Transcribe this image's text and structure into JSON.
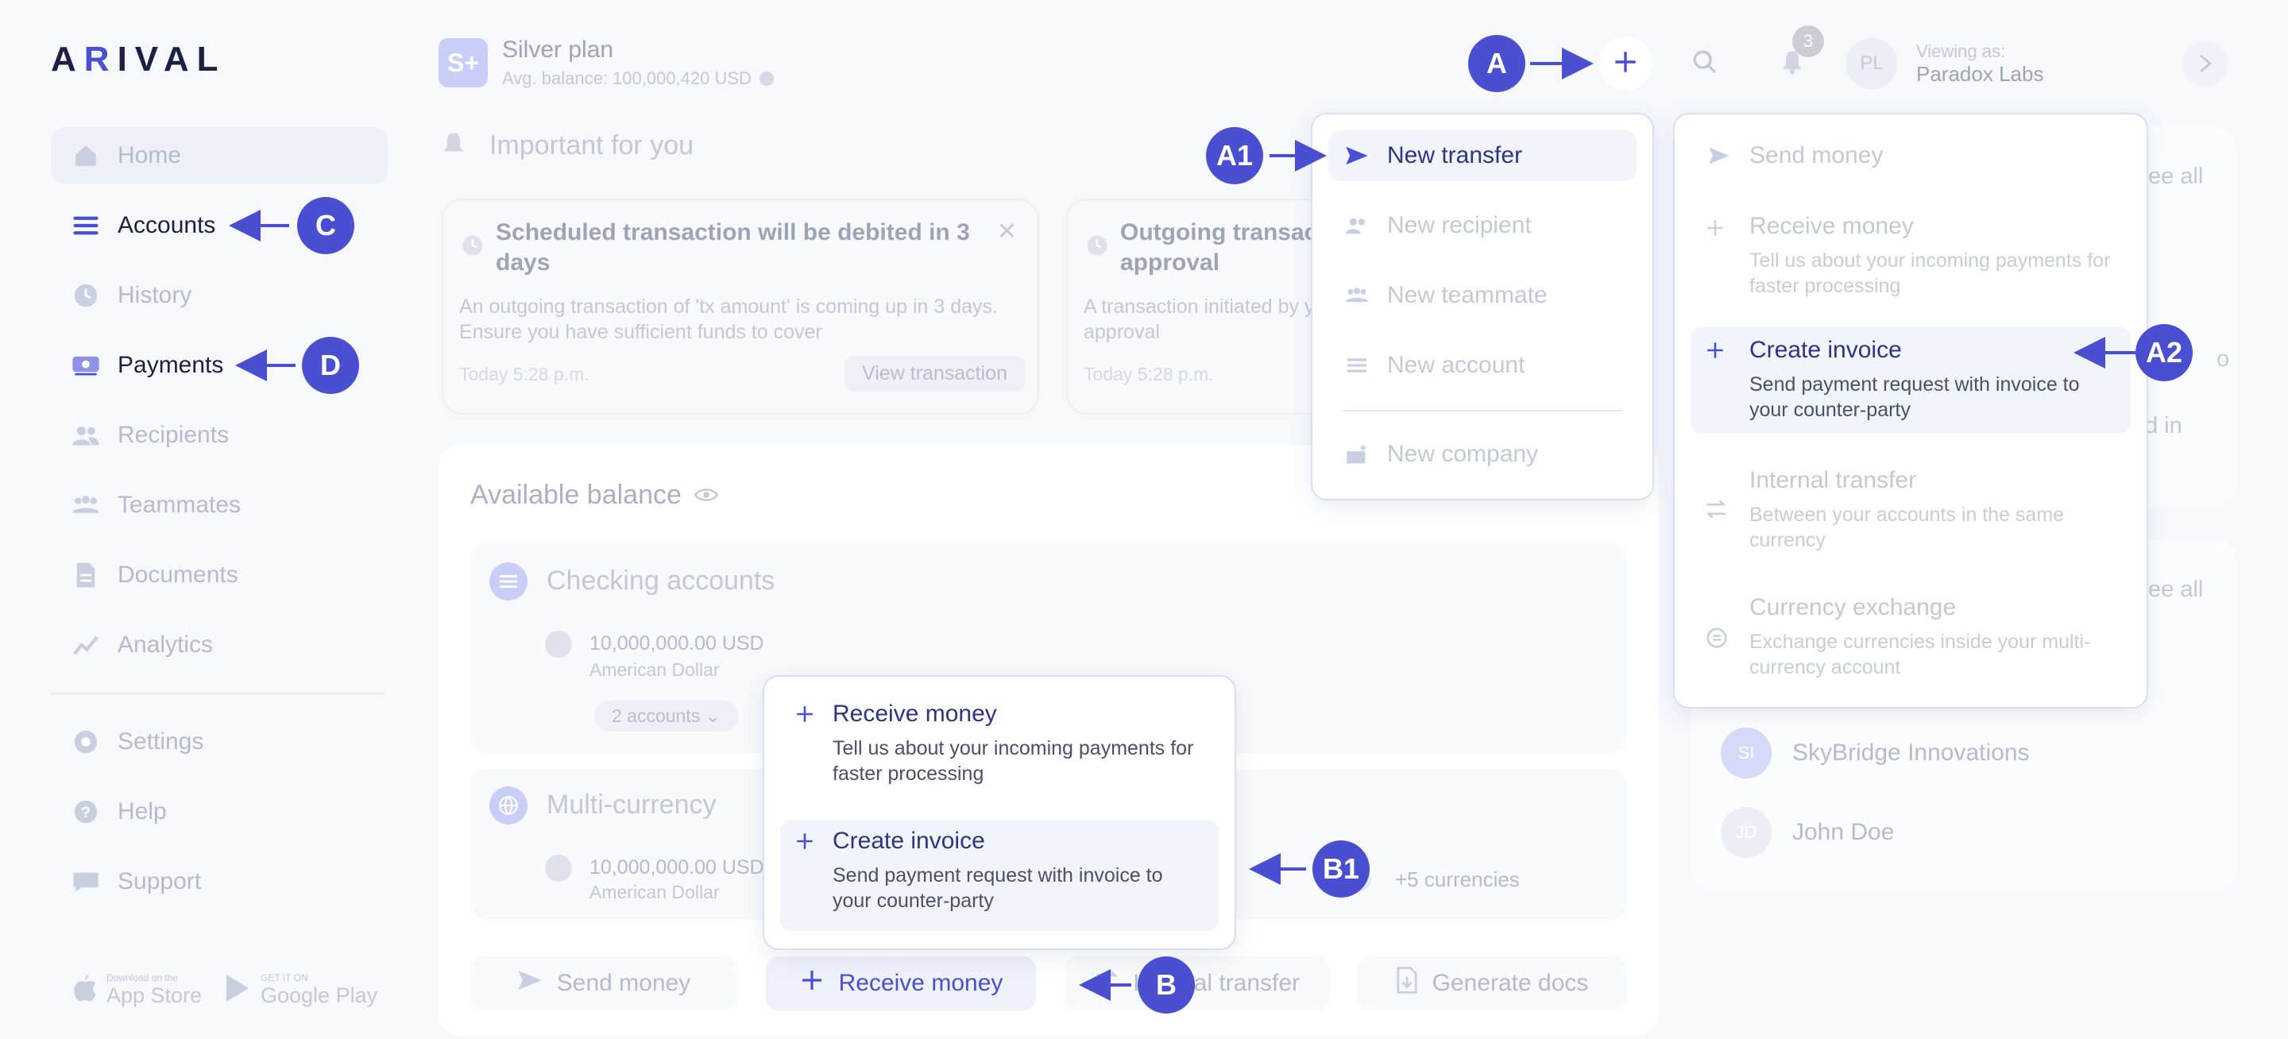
{
  "logo": {
    "text": "ARIVAL"
  },
  "sidebar": {
    "items": [
      {
        "label": "Home"
      },
      {
        "label": "Accounts"
      },
      {
        "label": "History"
      },
      {
        "label": "Payments"
      },
      {
        "label": "Recipients"
      },
      {
        "label": "Teammates"
      },
      {
        "label": "Documents"
      },
      {
        "label": "Analytics"
      },
      {
        "label": "Settings"
      },
      {
        "label": "Help"
      },
      {
        "label": "Support"
      }
    ],
    "app_store": {
      "small": "Download on the",
      "big": "App Store"
    },
    "google_play": {
      "small": "GET IT ON",
      "big": "Google Play"
    }
  },
  "header": {
    "plan_badge": "S+",
    "plan_name": "Silver plan",
    "avg_balance": "Avg. balance: 100,000,420 USD",
    "notifications_count": "3",
    "avatar_initials": "PL",
    "viewing_as_label": "Viewing as:",
    "viewing_as_company": "Paradox Labs"
  },
  "important": {
    "title": "Important for you",
    "cards": [
      {
        "title": "Scheduled transaction will be debited in 3 days",
        "body": "An outgoing transaction of 'tx amount' is coming up in 3 days. Ensure you have sufficient funds to cover",
        "time": "Today 5:28 p.m.",
        "action": "View transaction"
      },
      {
        "title": "Outgoing transaction approval",
        "body": "A transaction initiated by your approval",
        "time": "Today 5:28 p.m."
      }
    ]
  },
  "balance": {
    "title": "Available balance",
    "checking": {
      "title": "Checking accounts",
      "amount": "10,000,000.00 USD",
      "currency": "American Dollar",
      "accounts_chip": "2 accounts"
    },
    "multi": {
      "title": "Multi-currency",
      "amount": "10,000,000.00 USD",
      "currency": "American Dollar",
      "more": "+5 currencies"
    },
    "actions": {
      "send": "Send money",
      "receive": "Receive money",
      "internal": "Internal transfer",
      "docs": "Generate docs"
    }
  },
  "right_panel": {
    "see_all_1": "ee all",
    "see_all_2": "ee all",
    "frag_1": "o",
    "frag_2": "d in",
    "contacts": [
      {
        "initials": "SI",
        "name": "SkyBridge Innovations"
      },
      {
        "initials": "JD",
        "name": "John Doe"
      }
    ]
  },
  "menu_new": {
    "items": [
      "New transfer",
      "New recipient",
      "New teammate",
      "New account",
      "New company"
    ]
  },
  "menu_transfer": {
    "items": [
      {
        "title": "Send money",
        "desc": ""
      },
      {
        "title": "Receive money",
        "desc": "Tell us about your incoming payments for faster processing"
      },
      {
        "title": "Create invoice",
        "desc": "Send payment request with invoice to your counter-party"
      },
      {
        "title": "Internal transfer",
        "desc": "Between your accounts in the same currency"
      },
      {
        "title": "Currency exchange",
        "desc": "Exchange currencies inside your multi-currency account"
      }
    ]
  },
  "menu_receive": {
    "items": [
      {
        "title": "Receive money",
        "desc": "Tell us about your incoming payments for faster processing"
      },
      {
        "title": "Create invoice",
        "desc": "Send payment request with invoice to your counter-party"
      }
    ]
  },
  "callouts": {
    "a": "A",
    "a1": "A1",
    "a2": "A2",
    "b": "B",
    "b1": "B1",
    "c": "C",
    "d": "D"
  },
  "colors": {
    "accent": "#4a4fd1",
    "faded_text": "#b5bbcc",
    "background": "#f6f8fc"
  }
}
